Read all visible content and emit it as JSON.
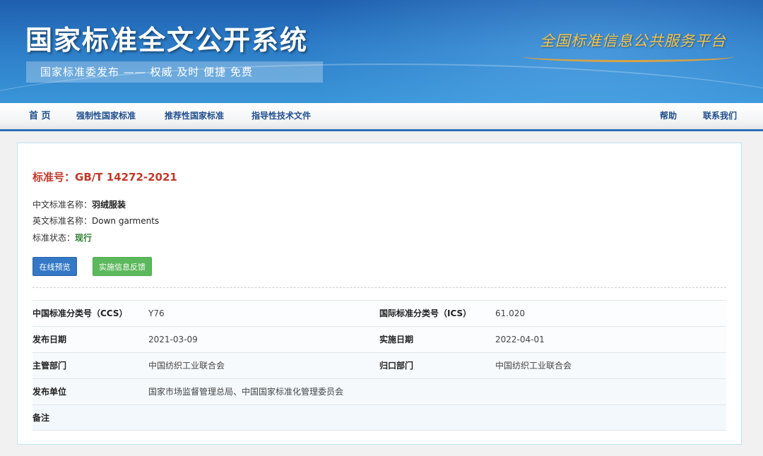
{
  "header": {
    "title": "国家标准全文公开系统",
    "slogan": "国家标准委发布 —— 权威 及时 便捷 免费",
    "platform": "全国标准信息公共服务平台"
  },
  "nav": {
    "home": "首 页",
    "mandatory": "强制性国家标准",
    "recommended": "推荐性国家标准",
    "guidance": "指导性技术文件",
    "help": "帮助",
    "contact": "联系我们"
  },
  "standard": {
    "number_label": "标准号：",
    "number": "GB/T 14272-2021",
    "cn_name_label": "中文标准名称：",
    "cn_name": "羽绒服装",
    "en_name_label": "英文标准名称：",
    "en_name": "Down garments",
    "status_label": "标准状态：",
    "status": "现行"
  },
  "actions": {
    "preview": "在线预览",
    "feedback": "实施信息反馈"
  },
  "info": {
    "ccs_label": "中国标准分类号（CCS）",
    "ccs": "Y76",
    "ics_label": "国际标准分类号（ICS）",
    "ics": "61.020",
    "publish_date_label": "发布日期",
    "publish_date": "2021-03-09",
    "implement_date_label": "实施日期",
    "implement_date": "2022-04-01",
    "competent_dept_label": "主管部门",
    "competent_dept": "中国纺织工业联合会",
    "belong_dept_label": "归口部门",
    "belong_dept": "中国纺织工业联合会",
    "publisher_label": "发布单位",
    "publisher": "国家市场监督管理总局、中国国家标准化管理委员会",
    "remark_label": "备注",
    "remark": ""
  }
}
